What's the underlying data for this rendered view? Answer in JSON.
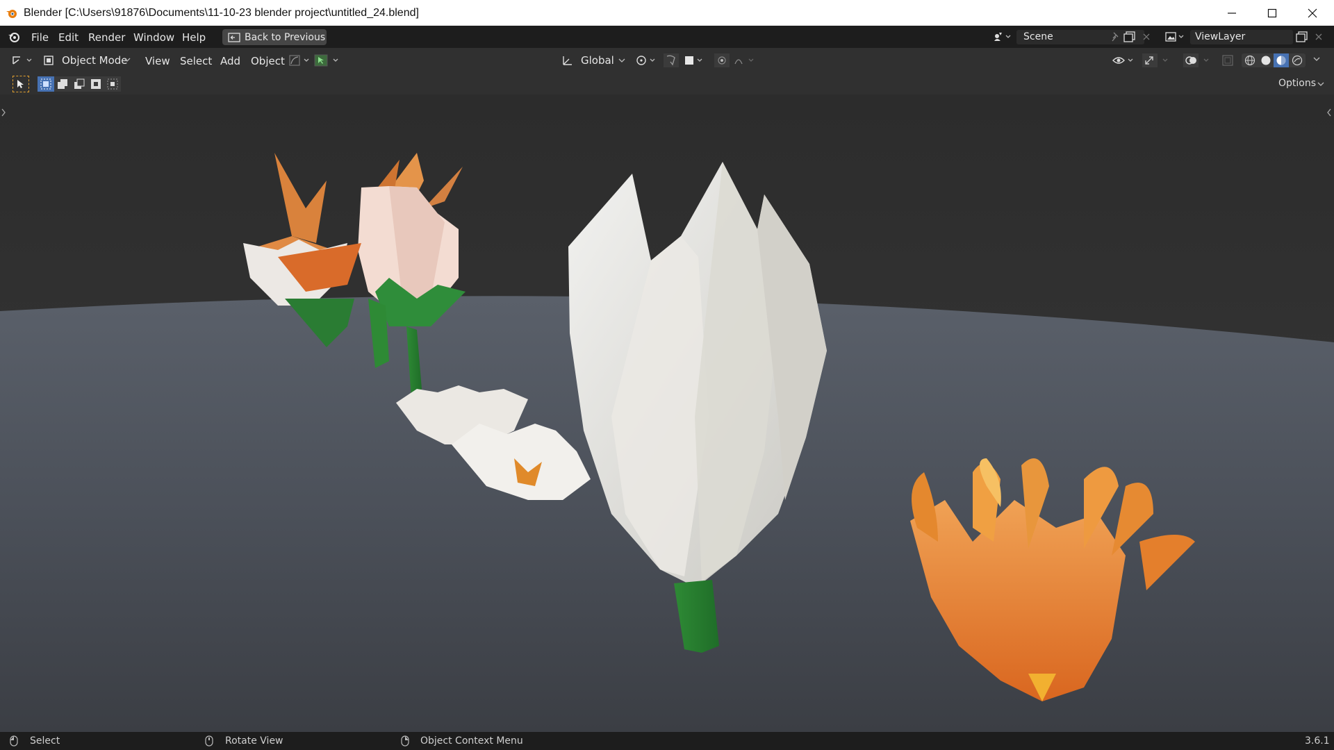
{
  "window": {
    "title": "Blender [C:\\Users\\91876\\Documents\\11-10-23 blender project\\untitled_24.blend]"
  },
  "menu": {
    "file": "File",
    "edit": "Edit",
    "render": "Render",
    "window": "Window",
    "help": "Help",
    "back_to_previous": "Back to Previous"
  },
  "scene": {
    "label": "Scene"
  },
  "view_layer": {
    "label": "ViewLayer"
  },
  "header": {
    "mode": "Object Mode",
    "view": "View",
    "select": "Select",
    "add": "Add",
    "object": "Object",
    "transform_orientation": "Global",
    "options": "Options"
  },
  "status": {
    "select": "Select",
    "rotate_view": "Rotate View",
    "context_menu": "Object Context Menu",
    "version": "3.6.1"
  },
  "colors": {
    "accent": "#4772b3",
    "panel": "#303030",
    "bar": "#1d1d1d"
  },
  "icons": [
    "blender-icon",
    "minimize-icon",
    "maximize-icon",
    "close-icon",
    "editor-type-icon",
    "object-mode-icon",
    "transform-orientation-icon",
    "pivot-icon",
    "snap-icon",
    "proportional-edit-icon",
    "visibility-icon",
    "gizmo-icon",
    "overlay-icon",
    "xray-icon",
    "wireframe-shading-icon",
    "solid-shading-icon",
    "material-shading-icon",
    "rendered-shading-icon",
    "select-box-icon",
    "mouse-left-icon",
    "mouse-middle-icon",
    "mouse-right-icon"
  ]
}
